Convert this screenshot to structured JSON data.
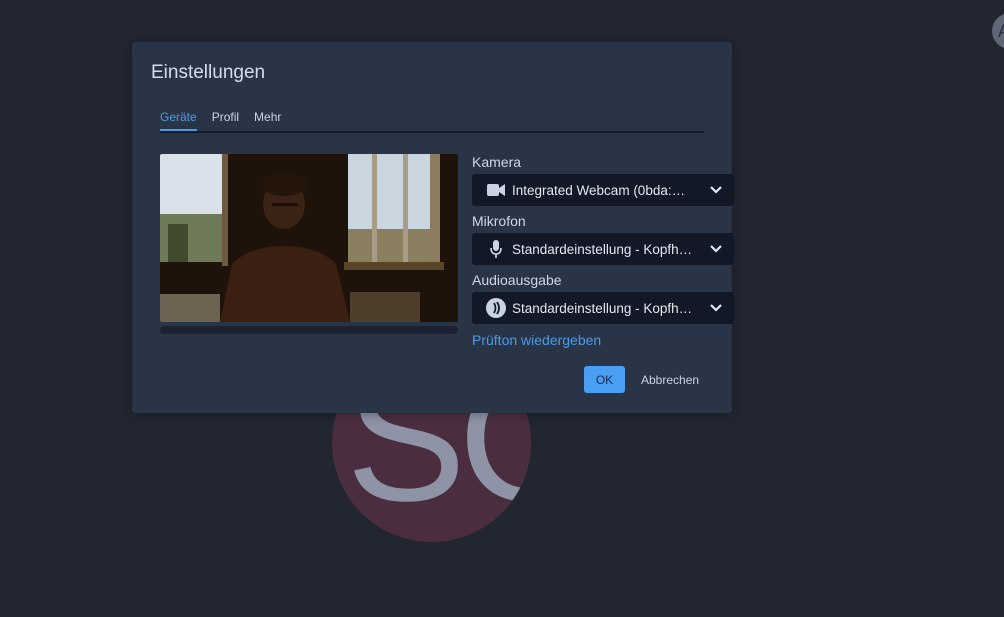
{
  "dialog": {
    "title": "Einstellungen",
    "tabs": [
      {
        "label": "Geräte",
        "active": true
      },
      {
        "label": "Profil",
        "active": false
      },
      {
        "label": "Mehr",
        "active": false
      }
    ]
  },
  "devices": {
    "camera": {
      "label": "Kamera",
      "value": "Integrated Webcam (0bda:…",
      "icon": "video-camera-icon"
    },
    "microphone": {
      "label": "Mikrofon",
      "value": "Standardeinstellung - Kopfh…",
      "icon": "microphone-icon"
    },
    "audio_output": {
      "label": "Audioausgabe",
      "value": "Standardeinstellung - Kopfh…",
      "icon": "speaker-icon"
    },
    "test_sound_link": "Prüfton wiedergeben"
  },
  "buttons": {
    "ok": "OK",
    "cancel": "Abbrechen"
  },
  "background": {
    "avatar_initials": "SC",
    "corner_avatar_initial": "A"
  },
  "colors": {
    "accent": "#4b9ae8",
    "dialog_bg": "#293447",
    "page_bg": "#222631"
  }
}
